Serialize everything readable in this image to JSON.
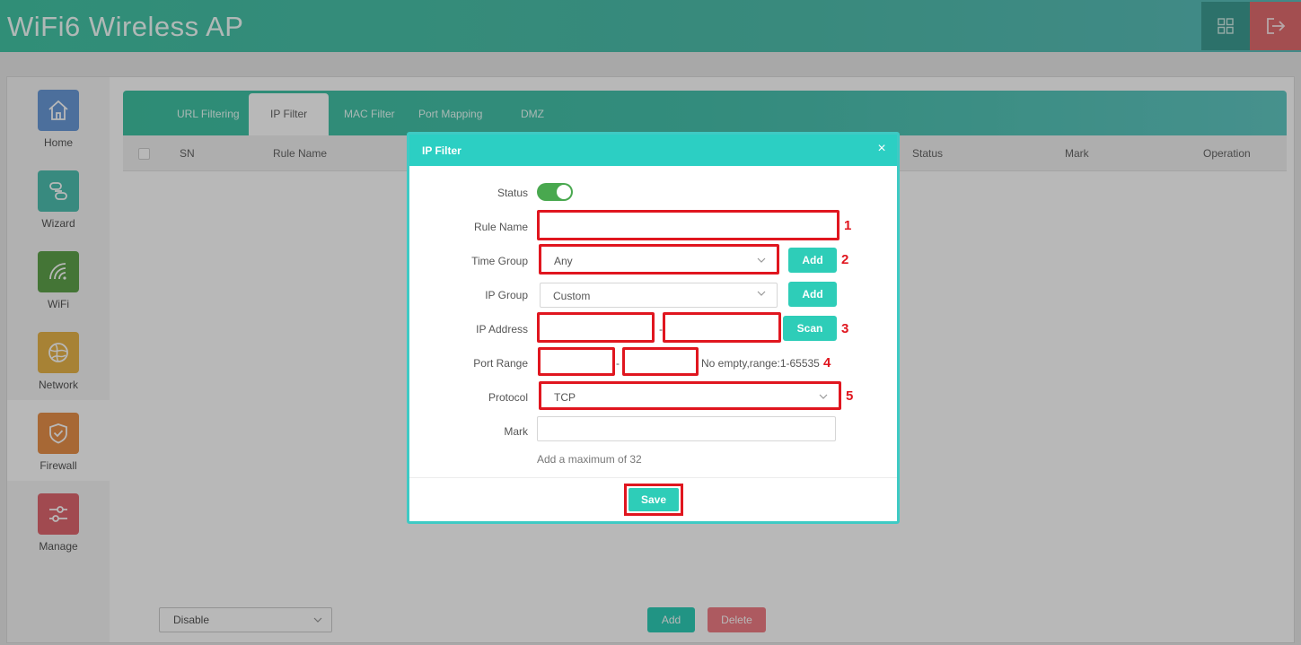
{
  "header": {
    "title": "WiFi6 Wireless AP",
    "grid_icon": "grid-icon",
    "exit_icon": "logout-icon"
  },
  "sidebar": {
    "items": [
      {
        "label": "Home",
        "icon": "home-icon",
        "color": "#6a9ad8"
      },
      {
        "label": "Wizard",
        "icon": "link-icon",
        "color": "#4ec0b0"
      },
      {
        "label": "WiFi",
        "icon": "wifi-icon",
        "color": "#5fa34b"
      },
      {
        "label": "Network",
        "icon": "globe-icon",
        "color": "#e8b54a"
      },
      {
        "label": "Firewall",
        "icon": "shield-check-icon",
        "color": "#e8904a"
      },
      {
        "label": "Manage",
        "icon": "sliders-icon",
        "color": "#e0676f"
      }
    ],
    "active": "Firewall"
  },
  "tabs": [
    "URL Filtering",
    "IP Filter",
    "MAC Filter",
    "Port Mapping",
    "DMZ"
  ],
  "active_tab": "IP Filter",
  "table": {
    "columns": [
      "SN",
      "Rule Name",
      "Status",
      "Mark",
      "Operation"
    ]
  },
  "bottom": {
    "select_value": "Disable",
    "add_label": "Add",
    "delete_label": "Delete"
  },
  "modal": {
    "title": "IP Filter",
    "close": "×",
    "labels": {
      "status": "Status",
      "rule_name": "Rule Name",
      "time_group": "Time Group",
      "ip_group": "IP Group",
      "ip_address": "IP Address",
      "port_range": "Port Range",
      "protocol": "Protocol",
      "mark": "Mark"
    },
    "status_on": true,
    "rule_name_value": "",
    "time_group_value": "Any",
    "ip_group_value": "Custom",
    "ip_start": "",
    "ip_end": "",
    "port_start": "",
    "port_end": "",
    "protocol_value": "TCP",
    "mark_value": "",
    "add_label": "Add",
    "scan_label": "Scan",
    "dash": "-",
    "port_hint": "No empty,range:1-65535",
    "mark_hint": "Add a maximum of 32",
    "save_label": "Save",
    "annotations": [
      "1",
      "2",
      "3",
      "4",
      "5"
    ]
  }
}
